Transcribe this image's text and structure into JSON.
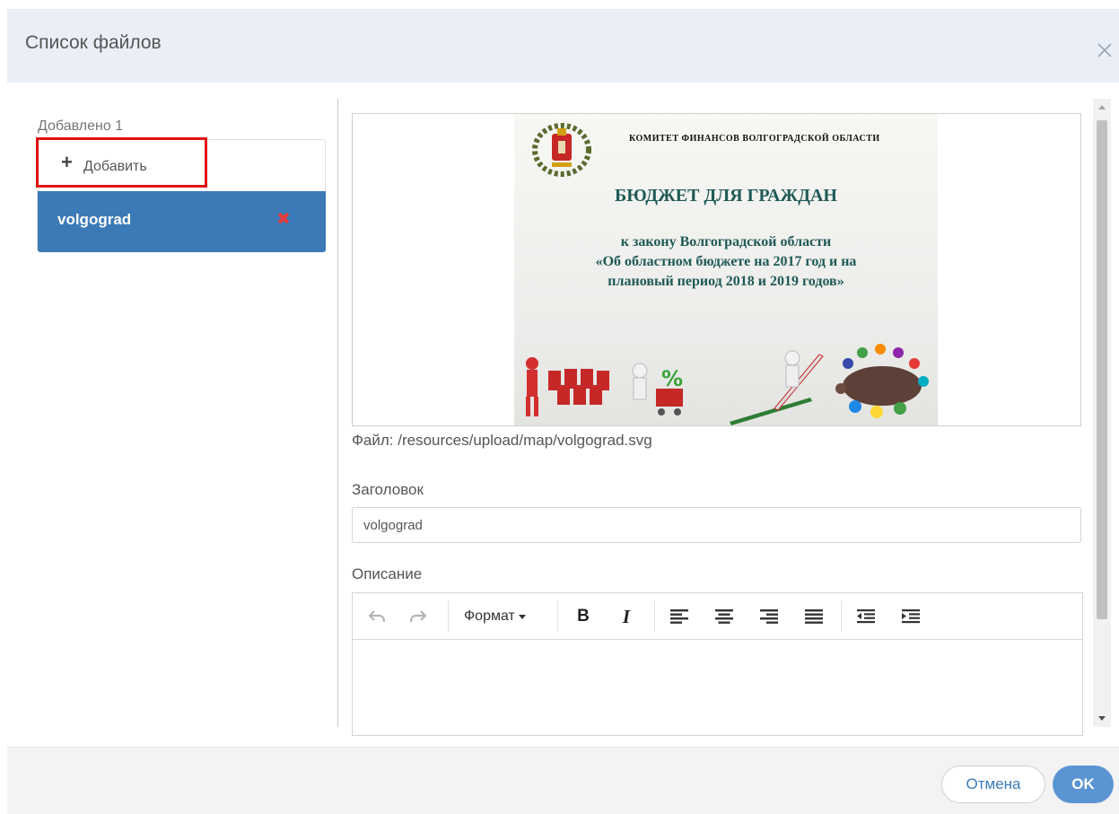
{
  "dialog": {
    "title": "Список файлов",
    "close_icon": "close-icon"
  },
  "files": {
    "added_label": "Добавлено 1",
    "add_label": "Добавить",
    "add_icon": "plus-icon",
    "items": [
      {
        "name": "volgograd",
        "delete_icon": "delete-x-icon"
      }
    ],
    "selected_color": "#3c7ab7",
    "highlight_color": "#e21010"
  },
  "preview": {
    "slide": {
      "org": "КОМИТЕТ ФИНАНСОВ ВОЛГОГРАДСКОЙ ОБЛАСТИ",
      "headline": "БЮДЖЕТ ДЛЯ ГРАЖДАН",
      "sub_lines": [
        "к закону Волгоградской области",
        "«Об областном бюджете на 2017 год и на",
        "плановый период 2018 и 2019 годов»"
      ]
    },
    "file_path": "Файл: /resources/upload/map/volgograd.svg"
  },
  "form": {
    "title_label": "Заголовок",
    "title_value": "volgograd",
    "description_label": "Описание"
  },
  "editor": {
    "undo_icon": "undo-icon",
    "redo_icon": "redo-icon",
    "format_label": "Формат",
    "bold_label": "B",
    "italic_label": "I",
    "align_icons": [
      "align-left-icon",
      "align-center-icon",
      "align-right-icon",
      "align-justify-icon"
    ],
    "indent_icons": [
      "outdent-icon",
      "indent-icon"
    ],
    "content": ""
  },
  "footer": {
    "cancel_label": "Отмена",
    "ok_label": "OK",
    "accent": "#5b94d3"
  }
}
